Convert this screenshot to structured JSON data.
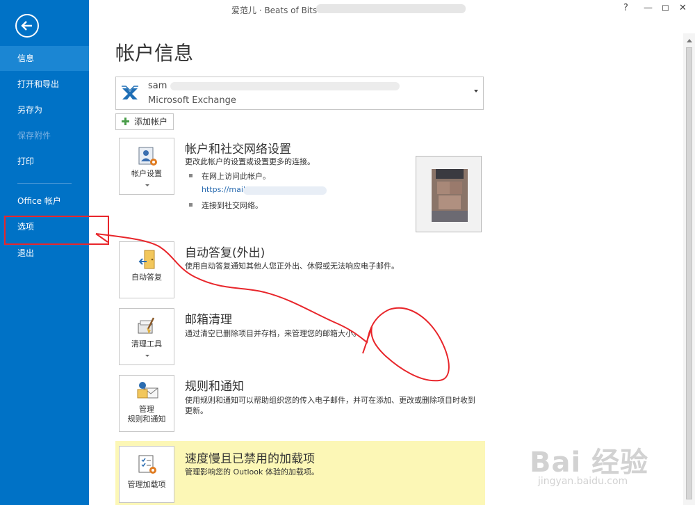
{
  "window": {
    "title": "爱范儿 · Beats of Bits -",
    "help": "?",
    "minimize": "—",
    "restore": "◻",
    "close": "✕"
  },
  "sidebar": {
    "items": [
      {
        "label": "信息"
      },
      {
        "label": "打开和导出"
      },
      {
        "label": "另存为"
      },
      {
        "label": "保存附件"
      },
      {
        "label": "打印"
      },
      {
        "label": "Office 帐户"
      },
      {
        "label": "选项"
      },
      {
        "label": "退出"
      }
    ]
  },
  "main": {
    "page_title": "帐户信息",
    "account": {
      "name": "sam",
      "type": "Microsoft Exchange"
    },
    "add_account": "添加帐户",
    "sections": {
      "account_settings": {
        "tile_label": "帐户设置",
        "title": "帐户和社交网络设置",
        "desc": "更改此帐户的设置或设置更多的连接。",
        "bullet1": "在网上访问此帐户。",
        "link": "https://mail.chu",
        "bullet2": "连接到社交网络。"
      },
      "auto_reply": {
        "tile_label": "自动答复",
        "title": "自动答复(外出)",
        "desc": "使用自动答复通知其他人您正外出、休假或无法响应电子邮件。"
      },
      "cleanup": {
        "tile_label": "清理工具",
        "title": "邮箱清理",
        "desc": "通过清空已删除项目并存档，来管理您的邮箱大小。"
      },
      "rules": {
        "tile_label_1": "管理",
        "tile_label_2": "规则和通知",
        "title": "规则和通知",
        "desc": "使用规则和通知可以帮助组织您的传入电子邮件，并可在添加、更改或删除项目时收到更新。"
      },
      "addins": {
        "tile_label": "管理加载项",
        "title": "速度慢且已禁用的加载项",
        "desc": "管理影响您的 Outlook 体验的加载项。"
      }
    }
  },
  "watermark": {
    "main": "Bai 经验",
    "sub": "jingyan.baidu.com"
  },
  "colors": {
    "sidebar": "#0072c6",
    "sidebar_active": "#1b86d3",
    "annotation": "#e8262b",
    "addin_band": "#fcf7b6"
  }
}
